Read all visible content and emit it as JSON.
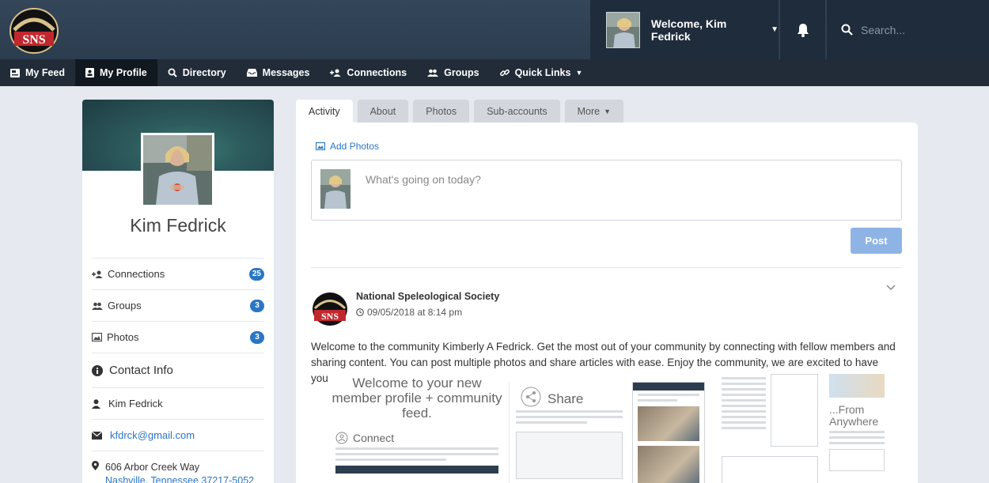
{
  "header": {
    "logo_name": "NSS logo",
    "welcome_text": "Welcome, Kim Fedrick",
    "search_placeholder": "Search..."
  },
  "nav": [
    {
      "label": "My Feed",
      "icon": "feed-icon",
      "active": false
    },
    {
      "label": "My Profile",
      "icon": "profile-icon",
      "active": true
    },
    {
      "label": "Directory",
      "icon": "search-icon",
      "active": false
    },
    {
      "label": "Messages",
      "icon": "inbox-icon",
      "active": false
    },
    {
      "label": "Connections",
      "icon": "connections-icon",
      "active": false
    },
    {
      "label": "Groups",
      "icon": "groups-icon",
      "active": false
    },
    {
      "label": "Quick Links",
      "icon": "link-icon",
      "active": false
    }
  ],
  "profile": {
    "name": "Kim Fedrick",
    "stats": [
      {
        "label": "Connections",
        "count": "25"
      },
      {
        "label": "Groups",
        "count": "3"
      },
      {
        "label": "Photos",
        "count": "3"
      }
    ],
    "contact_title": "Contact Info",
    "contact_name": "Kim Fedrick",
    "email": "kfdrck@gmail.com",
    "address_line1": "606 Arbor Creek Way",
    "address_line2": "Nashville, Tennessee 37217-5052"
  },
  "tabs": [
    "Activity",
    "About",
    "Photos",
    "Sub-accounts",
    "More"
  ],
  "composer": {
    "add_photos": "Add Photos",
    "placeholder": "What's going on today?",
    "post_label": "Post"
  },
  "post": {
    "author": "National Speleological Society",
    "time": "09/05/2018 at 8:14 pm",
    "body": "Welcome to the community Kimberly A Fedrick. Get the most out of your community by connecting with fellow members and sharing content. You can post multiple photos and share articles with ease. Enjoy the community, we are excited to have you!",
    "thumb_welcome": "Welcome to your new member profile + community feed.",
    "thumb_connect": "Connect",
    "thumb_share": "Share",
    "thumb_from": "...From Anywhere"
  },
  "colors": {
    "accent": "#2a76c6",
    "header_bg": "#2c3d50",
    "nav_bg": "#222c38",
    "page_bg": "#e6e9ef"
  }
}
